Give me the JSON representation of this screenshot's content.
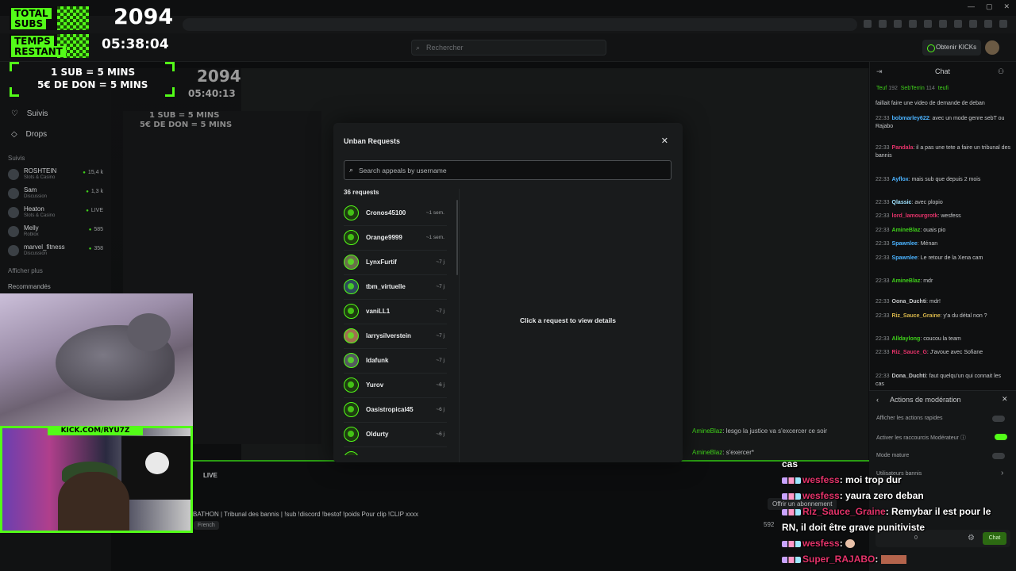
{
  "header": {
    "search_placeholder": "Rechercher",
    "kicks_label": "Obtenir KICKs"
  },
  "sidebar": {
    "nav": [
      {
        "label": "Suivis",
        "icon": "heart-icon"
      },
      {
        "label": "Drops",
        "icon": "drops-icon"
      }
    ],
    "following_label": "Suivis",
    "channels": [
      {
        "name": "ROSHTEIN",
        "category": "Slots & Casino",
        "viewers": "15,4 k"
      },
      {
        "name": "Sam",
        "category": "Discussion",
        "viewers": "1,3 k"
      },
      {
        "name": "Heaton",
        "category": "Slots & Casino",
        "viewers": "LIVE"
      },
      {
        "name": "Melly",
        "category": "Roblox",
        "viewers": "585"
      },
      {
        "name": "marvel_fitness",
        "category": "Discussion",
        "viewers": "358"
      }
    ],
    "show_more": "Afficher plus",
    "recommended_label": "Recommandés"
  },
  "overlay": {
    "total_subs_label_1": "TOTAL",
    "total_subs_label_2": "SUBS",
    "total_subs_value": "2094",
    "time_label_1": "TEMPS",
    "time_label_2": "RESTANT",
    "time_value": "05:38:04",
    "rule_1": "1 SUB = 5 MINS",
    "rule_2": "5€ DE DON = 5 MINS",
    "kick_url": "KICK.COM/RYU7Z",
    "inner_subs": "2094",
    "inner_time": "05:40:13",
    "inner_rule_1": "1 SUB = 5 MINS",
    "inner_rule_2": "5€ DE DON = 5 MINS"
  },
  "stream": {
    "live_label": "LIVE",
    "title": "BATHON | Tribunal des bannis | !sub !discord !bestof !poids Pour clip !CLIP xxxx",
    "language": "French",
    "subscribe_label": "Offrir un abonnement",
    "viewer_count": "592"
  },
  "modal": {
    "title": "Unban Requests",
    "search_placeholder": "Search appeals by username",
    "count_label": "36 requests",
    "detail_hint": "Click a request to view details",
    "requests": [
      {
        "username": "Cronos45100",
        "time": "~1 sem."
      },
      {
        "username": "Orange9999",
        "time": "~1 sem."
      },
      {
        "username": "LynxFurtif",
        "time": "~7 j"
      },
      {
        "username": "tbm_virtuelle",
        "time": "~7 j"
      },
      {
        "username": "vaniLL1",
        "time": "~7 j"
      },
      {
        "username": "larrysilverstein",
        "time": "~7 j"
      },
      {
        "username": "Idafunk",
        "time": "~7 j"
      },
      {
        "username": "Yurov",
        "time": "~6 j"
      },
      {
        "username": "Oasistropical45",
        "time": "~6 j"
      },
      {
        "username": "Oldurty",
        "time": "~6 j"
      }
    ]
  },
  "chat": {
    "title": "Chat",
    "pinned": [
      {
        "user": "Teuf",
        "count": "192"
      },
      {
        "user": "SebTerrin",
        "count": "114"
      },
      {
        "user": "teufi",
        "count": ""
      }
    ],
    "messages": [
      {
        "time": "",
        "user": "",
        "text": "faillait faire une video de demande de deban"
      },
      {
        "time": "22:33",
        "user": "bobmarley622",
        "text": "avec un mode genre sebT ou Rajabo"
      },
      {
        "time": "22:33",
        "user": "Pandala",
        "text": "il a pas une tete a faire un tribunal des bannis"
      },
      {
        "time": "22:33",
        "user": "Ayflox",
        "text": "mais sub que depuis 2 mois"
      },
      {
        "time": "22:33",
        "user": "Qlassic",
        "text": "avec plopio"
      },
      {
        "time": "22:33",
        "user": "lord_lamourgrotk",
        "text": "wesfess"
      },
      {
        "time": "22:33",
        "user": "AmineBlaz",
        "text": "ouais pio"
      },
      {
        "time": "22:33",
        "user": "Spawnlee",
        "text": "Ménan"
      },
      {
        "time": "22:33",
        "user": "Spawnlee",
        "text": "Le retour de la Xena cam"
      },
      {
        "time": "22:33",
        "user": "AmineBlaz",
        "text": "mdr"
      },
      {
        "time": "22:33",
        "user": "Oona_Duchti",
        "text": "mdr!"
      },
      {
        "time": "22:33",
        "user": "Riz_Sauce_Graine",
        "text": "y'a du détal non ?"
      },
      {
        "time": "22:33",
        "user": "Alldaylong",
        "text": "coucou la team"
      },
      {
        "time": "22:33",
        "user": "Riz_Sauce_G",
        "text": "J'avoue avec Sofiane"
      },
      {
        "time": "22:33",
        "user": "Dona_Duchti",
        "text": "faut quelqu'un qui connait les cas"
      }
    ],
    "mod_panel": {
      "title": "Actions de modération",
      "rows": [
        {
          "label": "Afficher les actions rapides",
          "on": false
        },
        {
          "label": "Activer les raccourcis Modérateur",
          "on": true
        },
        {
          "label": "Mode mature",
          "on": false
        },
        {
          "label": "Utilisateurs bannis",
          "on": null
        }
      ]
    },
    "send_label": "Chat",
    "points": "0"
  },
  "overlay_chat": [
    {
      "user": "",
      "text": "cas"
    },
    {
      "user": "wesfess",
      "text": ": moi trop dur"
    },
    {
      "user": "wesfess",
      "text": ": yaura zero deban"
    },
    {
      "user": "Riz_Sauce_Graine",
      "text": ": Remybar il est pour le"
    },
    {
      "user": "",
      "text": "RN, il doit être grave punitiviste"
    },
    {
      "user": "wesfess",
      "text": ":"
    },
    {
      "user": "Super_RAJABO",
      "text": ":"
    }
  ],
  "stream_chat_fragments": [
    {
      "user": "AmineBlaz",
      "text": ": lesgo la justice va s'excercer ce soir"
    },
    {
      "user": "AmineBlaz",
      "text": ": s'exercer*"
    }
  ],
  "colors": {
    "kick_green": "#53fc18",
    "modal_bg": "#191b1c",
    "chat_user_red": "#e4336a"
  }
}
